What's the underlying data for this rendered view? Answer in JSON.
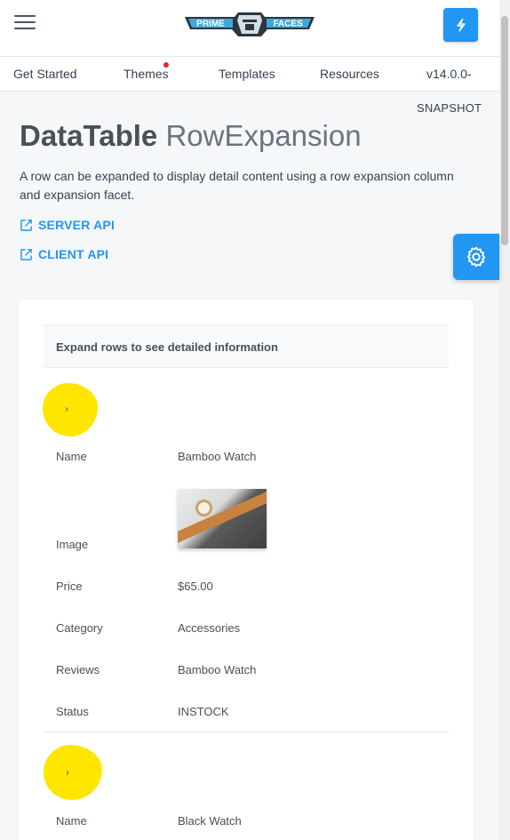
{
  "header": {
    "logo_left": "PRIME",
    "logo_right": "FACES"
  },
  "menu": {
    "items": [
      "Get Started",
      "Themes",
      "Templates",
      "Resources",
      "v14.0.0-"
    ],
    "version_suffix": "SNAPSHOT"
  },
  "page": {
    "title_bold": "DataTable",
    "title_light": "RowExpansion",
    "description": "A row can be expanded to display detail content using a row expansion column and expansion facet.",
    "links": [
      "SERVER API",
      "CLIENT API"
    ]
  },
  "table": {
    "header": "Expand rows to see detailed information",
    "toggler_glyph": "›",
    "labels": {
      "name": "Name",
      "image": "Image",
      "price": "Price",
      "category": "Category",
      "reviews": "Reviews",
      "status": "Status"
    },
    "rows": [
      {
        "name": "Bamboo Watch",
        "price": "$65.00",
        "category": "Accessories",
        "reviews": "Bamboo Watch",
        "status": "INSTOCK"
      },
      {
        "name": "Black Watch"
      }
    ]
  },
  "colors": {
    "accent": "#2196f3",
    "highlight": "#ffe600",
    "notification_dot": "#e0242e"
  }
}
